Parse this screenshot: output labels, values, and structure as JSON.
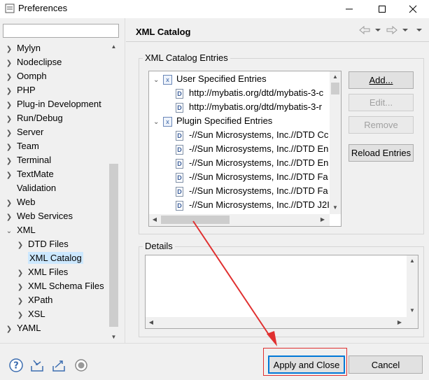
{
  "window": {
    "title": "Preferences"
  },
  "sidebar": {
    "items": [
      {
        "label": "Mylyn",
        "expanded": false,
        "level": 0
      },
      {
        "label": "Nodeclipse",
        "expanded": false,
        "level": 0
      },
      {
        "label": "Oomph",
        "expanded": false,
        "level": 0
      },
      {
        "label": "PHP",
        "expanded": false,
        "level": 0
      },
      {
        "label": "Plug-in Development",
        "expanded": false,
        "level": 0
      },
      {
        "label": "Run/Debug",
        "expanded": false,
        "level": 0
      },
      {
        "label": "Server",
        "expanded": false,
        "level": 0
      },
      {
        "label": "Team",
        "expanded": false,
        "level": 0
      },
      {
        "label": "Terminal",
        "expanded": false,
        "level": 0
      },
      {
        "label": "TextMate",
        "expanded": false,
        "level": 0
      },
      {
        "label": "Validation",
        "expanded": null,
        "level": 0
      },
      {
        "label": "Web",
        "expanded": false,
        "level": 0
      },
      {
        "label": "Web Services",
        "expanded": false,
        "level": 0
      },
      {
        "label": "XML",
        "expanded": true,
        "level": 0
      },
      {
        "label": "DTD Files",
        "expanded": false,
        "level": 1
      },
      {
        "label": "XML Catalog",
        "expanded": null,
        "level": 1,
        "selected": true
      },
      {
        "label": "XML Files",
        "expanded": false,
        "level": 1
      },
      {
        "label": "XML Schema Files",
        "expanded": false,
        "level": 1
      },
      {
        "label": "XPath",
        "expanded": false,
        "level": 1
      },
      {
        "label": "XSL",
        "expanded": false,
        "level": 1
      },
      {
        "label": "YAML",
        "expanded": false,
        "level": 0
      }
    ]
  },
  "page": {
    "title": "XML Catalog",
    "entries_group_label": "XML Catalog Entries",
    "details_group_label": "Details",
    "entries": [
      {
        "label": "User Specified Entries",
        "type": "group"
      },
      {
        "label": "http://mybatis.org/dtd/mybatis-3-c",
        "type": "entry"
      },
      {
        "label": "http://mybatis.org/dtd/mybatis-3-r",
        "type": "entry"
      },
      {
        "label": "Plugin Specified Entries",
        "type": "group"
      },
      {
        "label": "-//Sun Microsystems, Inc.//DTD Cc",
        "type": "entry"
      },
      {
        "label": "-//Sun Microsystems, Inc.//DTD En",
        "type": "entry"
      },
      {
        "label": "-//Sun Microsystems, Inc.//DTD En",
        "type": "entry"
      },
      {
        "label": "-//Sun Microsystems, Inc.//DTD Fa",
        "type": "entry"
      },
      {
        "label": "-//Sun Microsystems, Inc.//DTD Fa",
        "type": "entry"
      },
      {
        "label": "-//Sun Microsystems, Inc.//DTD J2I",
        "type": "entry"
      }
    ],
    "buttons": {
      "add": "Add...",
      "edit": "Edit...",
      "remove": "Remove",
      "reload": "Reload Entries"
    }
  },
  "footer": {
    "apply_close": "Apply and Close",
    "cancel": "Cancel"
  },
  "colors": {
    "selection": "#cce8ff",
    "highlight": "#e03030",
    "accent": "#0078d7"
  }
}
